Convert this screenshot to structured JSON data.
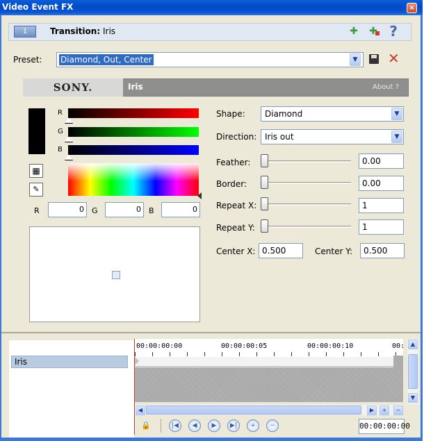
{
  "window": {
    "title": "Video Event FX",
    "close_glyph": "×"
  },
  "transition": {
    "badge": "1",
    "label": "Transition:",
    "name": "Iris"
  },
  "toolbar": {
    "icons": [
      "plugin-chain-icon",
      "remove-plugin-icon",
      "help-icon"
    ],
    "help_glyph": "?"
  },
  "preset": {
    "label": "Preset:",
    "value": "Diamond, Out, Center"
  },
  "header": {
    "brand": "SONY.",
    "plugin": "Iris",
    "about": "About ?"
  },
  "color": {
    "channels": [
      "R",
      "G",
      "B"
    ],
    "r_value": "0",
    "g_value": "0",
    "b_value": "0",
    "swatch_color": "#000000"
  },
  "params": {
    "shape_label": "Shape:",
    "shape_value": "Diamond",
    "direction_label": "Direction:",
    "direction_value": "Iris out",
    "feather_label": "Feather:",
    "feather_value": "0.00",
    "border_label": "Border:",
    "border_value": "0.00",
    "repeat_x_label": "Repeat X:",
    "repeat_x_value": "1",
    "repeat_y_label": "Repeat Y:",
    "repeat_y_value": "1",
    "center_x_label": "Center X:",
    "center_x_value": "0.500",
    "center_y_label": "Center Y:",
    "center_y_value": "0.500"
  },
  "timeline": {
    "track": "Iris",
    "ruler": [
      "00:00:00:00",
      "00:00:00:05",
      "00:00:00:10",
      "00:"
    ],
    "timecode": "00:00:00:00"
  }
}
